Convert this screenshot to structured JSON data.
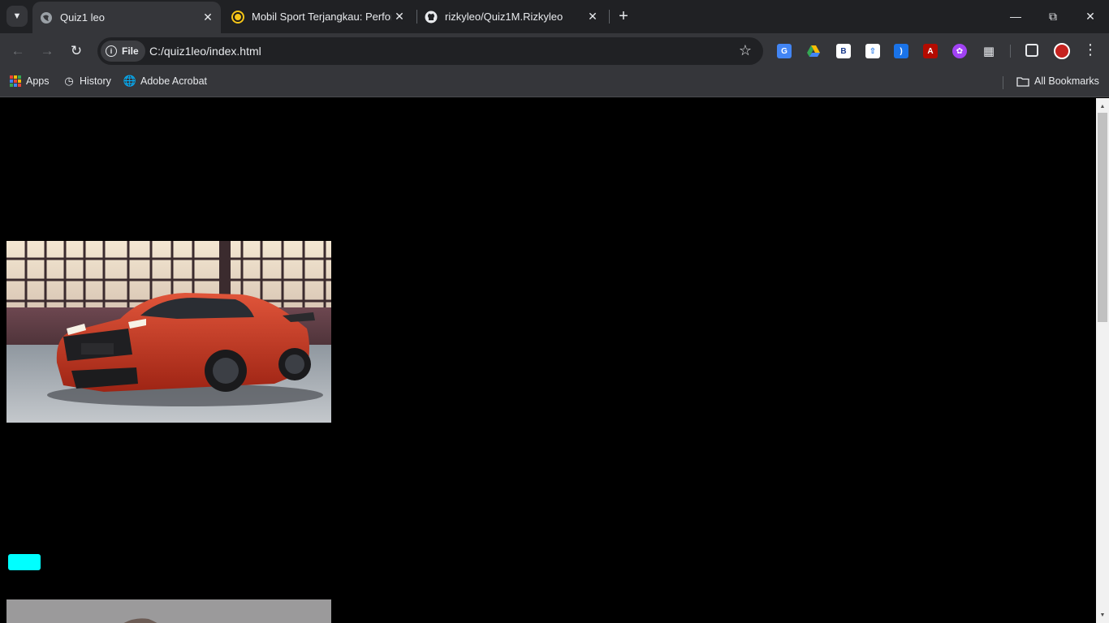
{
  "tabs": [
    {
      "title": "Quiz1 leo",
      "active": true
    },
    {
      "title": "Mobil Sport Terjangkau: Perform",
      "active": false
    },
    {
      "title": "rizkyleo/Quiz1M.Rizkyleo",
      "active": false
    }
  ],
  "omnibox": {
    "chip_label": "File",
    "url": "C:/quiz1leo/index.html"
  },
  "bookmarks": {
    "items": [
      {
        "label": "Apps",
        "icon": "apps-grid-icon"
      },
      {
        "label": "History",
        "icon": "history-icon"
      },
      {
        "label": "Adobe Acrobat",
        "icon": "globe-icon"
      }
    ],
    "all_bookmarks": "All Bookmarks"
  },
  "extensions": [
    {
      "name": "google-translate-icon",
      "color": "#4285f4"
    },
    {
      "name": "google-drive-icon",
      "color": "#fbbc04"
    },
    {
      "name": "b-extension-icon",
      "color": "#ffffff"
    },
    {
      "name": "upload-extension-icon",
      "color": "#1a73e8"
    },
    {
      "name": "wifi-extension-icon",
      "color": "#1a73e8"
    },
    {
      "name": "adobe-acrobat-icon",
      "color": "#b30b00"
    },
    {
      "name": "brain-extension-icon",
      "color": "#a142f4"
    },
    {
      "name": "puzzle-icon",
      "color": "#e8eaed"
    }
  ],
  "colors": {
    "page_background": "#000000",
    "button_color": "#00ffff",
    "car_body": "#c8341f"
  }
}
